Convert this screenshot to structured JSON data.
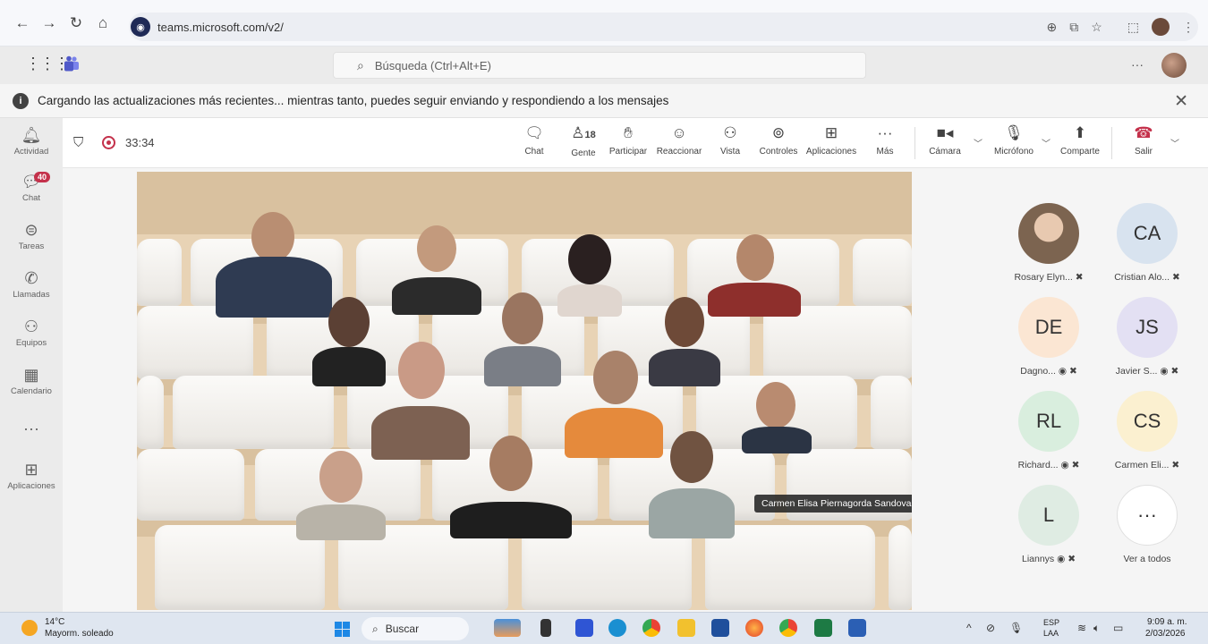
{
  "browser": {
    "url": "teams.microsoft.com/v2/"
  },
  "teams": {
    "search_placeholder": "Búsqueda (Ctrl+Alt+E)",
    "more": "···"
  },
  "banner": {
    "text": "Cargando las actualizaciones más recientes... mientras tanto, puedes seguir enviando y respondiendo a los mensajes",
    "info_icon": "i"
  },
  "rail": [
    {
      "label": "Actividad",
      "icon": "bell-icon",
      "glyph": "🔔"
    },
    {
      "label": "Chat",
      "icon": "chat-icon",
      "glyph": "💬",
      "badge": "40"
    },
    {
      "label": "Tareas",
      "icon": "tasks-icon",
      "glyph": "⊜"
    },
    {
      "label": "Llamadas",
      "icon": "phone-icon",
      "glyph": "✆"
    },
    {
      "label": "Equipos",
      "icon": "teams-icon",
      "glyph": "⚇"
    },
    {
      "label": "Calendario",
      "icon": "calendar-icon",
      "glyph": "▦"
    },
    {
      "label": "···",
      "icon": "more-icon",
      "glyph": ""
    },
    {
      "label": "Aplicaciones",
      "icon": "apps-icon",
      "glyph": "⊞"
    }
  ],
  "meeting": {
    "timer": "33:34",
    "toolbar": {
      "chat": "Chat",
      "people": "Gente",
      "people_count": "18",
      "raise": "Participar",
      "react": "Reaccionar",
      "view": "Vista",
      "controls": "Controles",
      "apps": "Aplicaciones",
      "more": "Más",
      "camera": "Cámara",
      "mic": "Micrófono",
      "share": "Comparte",
      "leave": "Salir"
    },
    "tooltip": "Carmen Elisa Piernagorda Sandoval"
  },
  "participants": [
    {
      "initials": "",
      "name": "Rosary Elyn...",
      "bg": "#b9a38c",
      "photo": true,
      "mic_off": true,
      "camera_off": false
    },
    {
      "initials": "CA",
      "name": "Cristian Alo...",
      "bg": "#d8e3ef",
      "photo": false,
      "mic_off": true,
      "camera_off": false
    },
    {
      "initials": "DE",
      "name": "Dagno...",
      "bg": "#fbe6d3",
      "photo": false,
      "mic_off": true,
      "camera_off": true
    },
    {
      "initials": "JS",
      "name": "Javier S...",
      "bg": "#e3e0f3",
      "photo": false,
      "mic_off": true,
      "camera_off": true
    },
    {
      "initials": "RL",
      "name": "Richard...",
      "bg": "#d9eede",
      "photo": false,
      "mic_off": true,
      "camera_off": true
    },
    {
      "initials": "CS",
      "name": "Carmen Eli...",
      "bg": "#fbf0d0",
      "photo": false,
      "mic_off": true,
      "camera_off": false
    },
    {
      "initials": "L",
      "name": "Liannys",
      "bg": "#dfece3",
      "photo": false,
      "mic_off": true,
      "camera_off": true
    },
    {
      "initials": "···",
      "name": "Ver a todos",
      "bg": "#ffffff",
      "photo": false,
      "mic_off": false,
      "camera_off": false
    }
  ],
  "taskbar": {
    "weather_temp": "14°C",
    "weather_desc": "Mayorm. soleado",
    "search": "Buscar",
    "lang1": "ESP",
    "lang2": "LAA",
    "time": "9:09 a. m.",
    "date": "2/03/2026"
  }
}
